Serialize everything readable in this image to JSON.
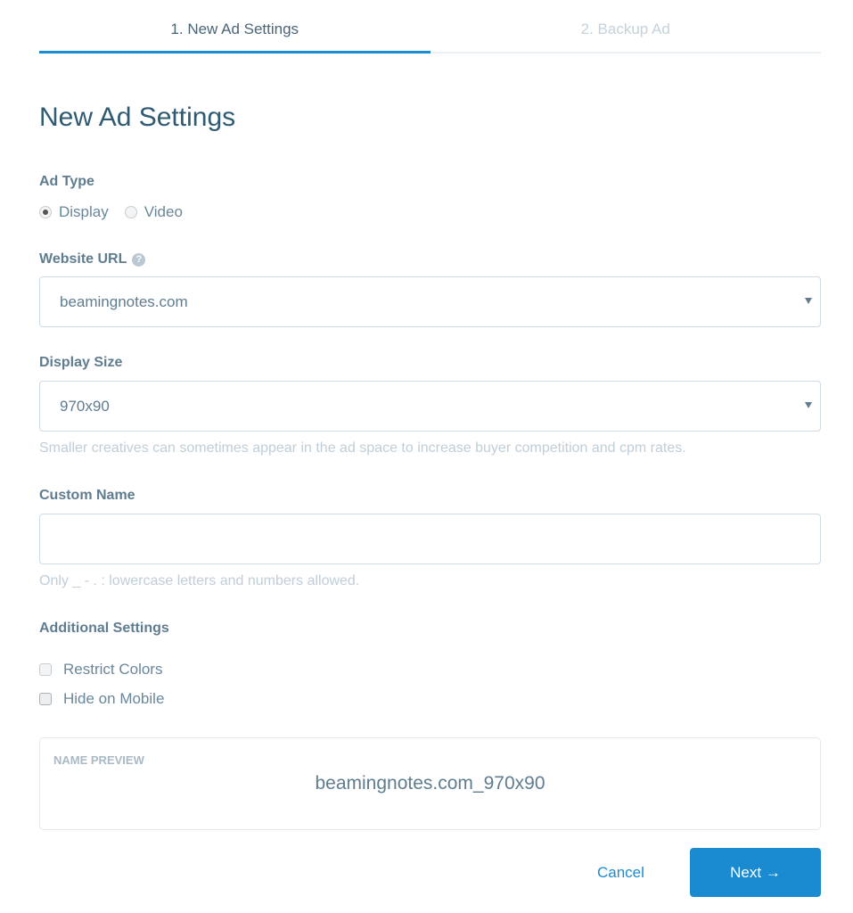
{
  "steps": [
    {
      "label": "1. New Ad Settings",
      "active": true
    },
    {
      "label": "2. Backup Ad",
      "active": false
    }
  ],
  "title": "New Ad Settings",
  "ad_type": {
    "label": "Ad Type",
    "options": [
      {
        "label": "Display",
        "selected": true
      },
      {
        "label": "Video",
        "selected": false
      }
    ]
  },
  "website_url": {
    "label": "Website URL",
    "help_icon": "question-circle-icon",
    "value": "beamingnotes.com"
  },
  "display_size": {
    "label": "Display Size",
    "value": "970x90",
    "hint": "Smaller creatives can sometimes appear in the ad space to increase buyer competition and cpm rates."
  },
  "custom_name": {
    "label": "Custom Name",
    "value": "",
    "placeholder": "",
    "hint": "Only _ - . : lowercase letters and numbers allowed."
  },
  "additional_settings": {
    "label": "Additional Settings",
    "options": [
      {
        "label": "Restrict Colors",
        "checked": false
      },
      {
        "label": "Hide on Mobile",
        "checked": false
      }
    ]
  },
  "name_preview": {
    "label": "NAME PREVIEW",
    "value": "beamingnotes.com_970x90"
  },
  "actions": {
    "cancel_label": "Cancel",
    "next_label": "Next →"
  },
  "colors": {
    "accent": "#1a8bd0",
    "title": "#2e5a72",
    "label": "#5f7d8f",
    "hint": "#c0ced7"
  }
}
